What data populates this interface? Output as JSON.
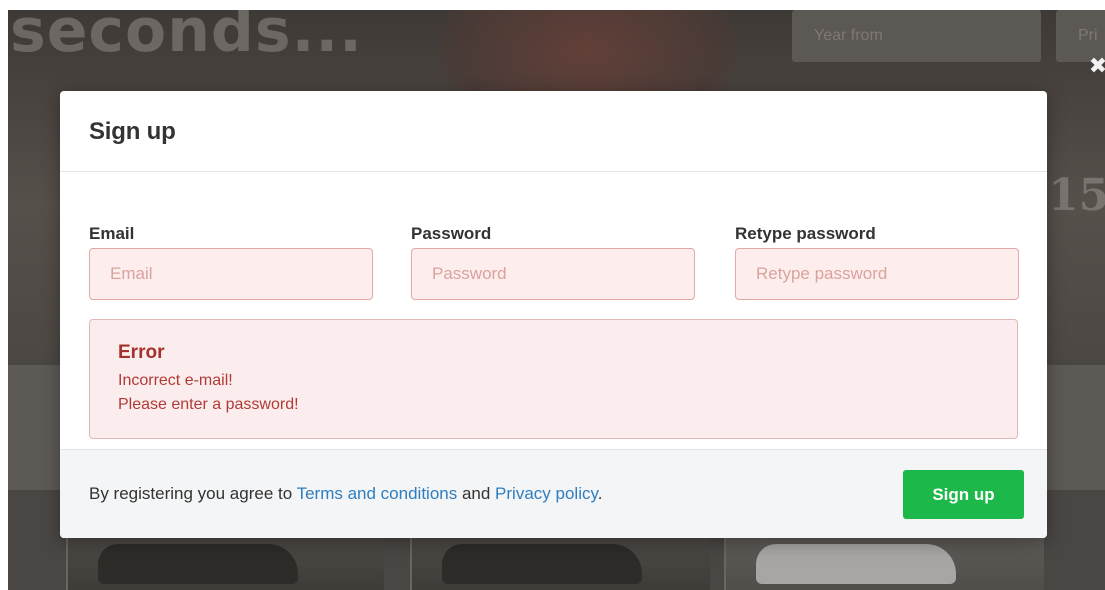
{
  "background": {
    "hero_text": "seconds...",
    "year_placeholder": "Year from",
    "price_placeholder": "Pri",
    "sign_text": "15"
  },
  "overlay": {
    "close_glyph": "✖"
  },
  "modal": {
    "title": "Sign up",
    "fields": [
      {
        "label": "Email",
        "placeholder": "Email",
        "value": ""
      },
      {
        "label": "Password",
        "placeholder": "Password",
        "value": ""
      },
      {
        "label": "Retype password",
        "placeholder": "Retype password",
        "value": ""
      }
    ],
    "error": {
      "title": "Error",
      "messages": [
        "Incorrect e-mail!",
        "Please enter a password!"
      ]
    },
    "footer": {
      "agree_prefix": "By registering you agree to ",
      "terms_link": "Terms and conditions",
      "and_text": " and ",
      "privacy_link": "Privacy policy",
      "suffix": ".",
      "submit_label": "Sign up"
    }
  },
  "colors": {
    "primary_button": "#1db84a",
    "link": "#2f7ebf",
    "error_text": "#a4312c",
    "error_background": "#fbeded"
  }
}
